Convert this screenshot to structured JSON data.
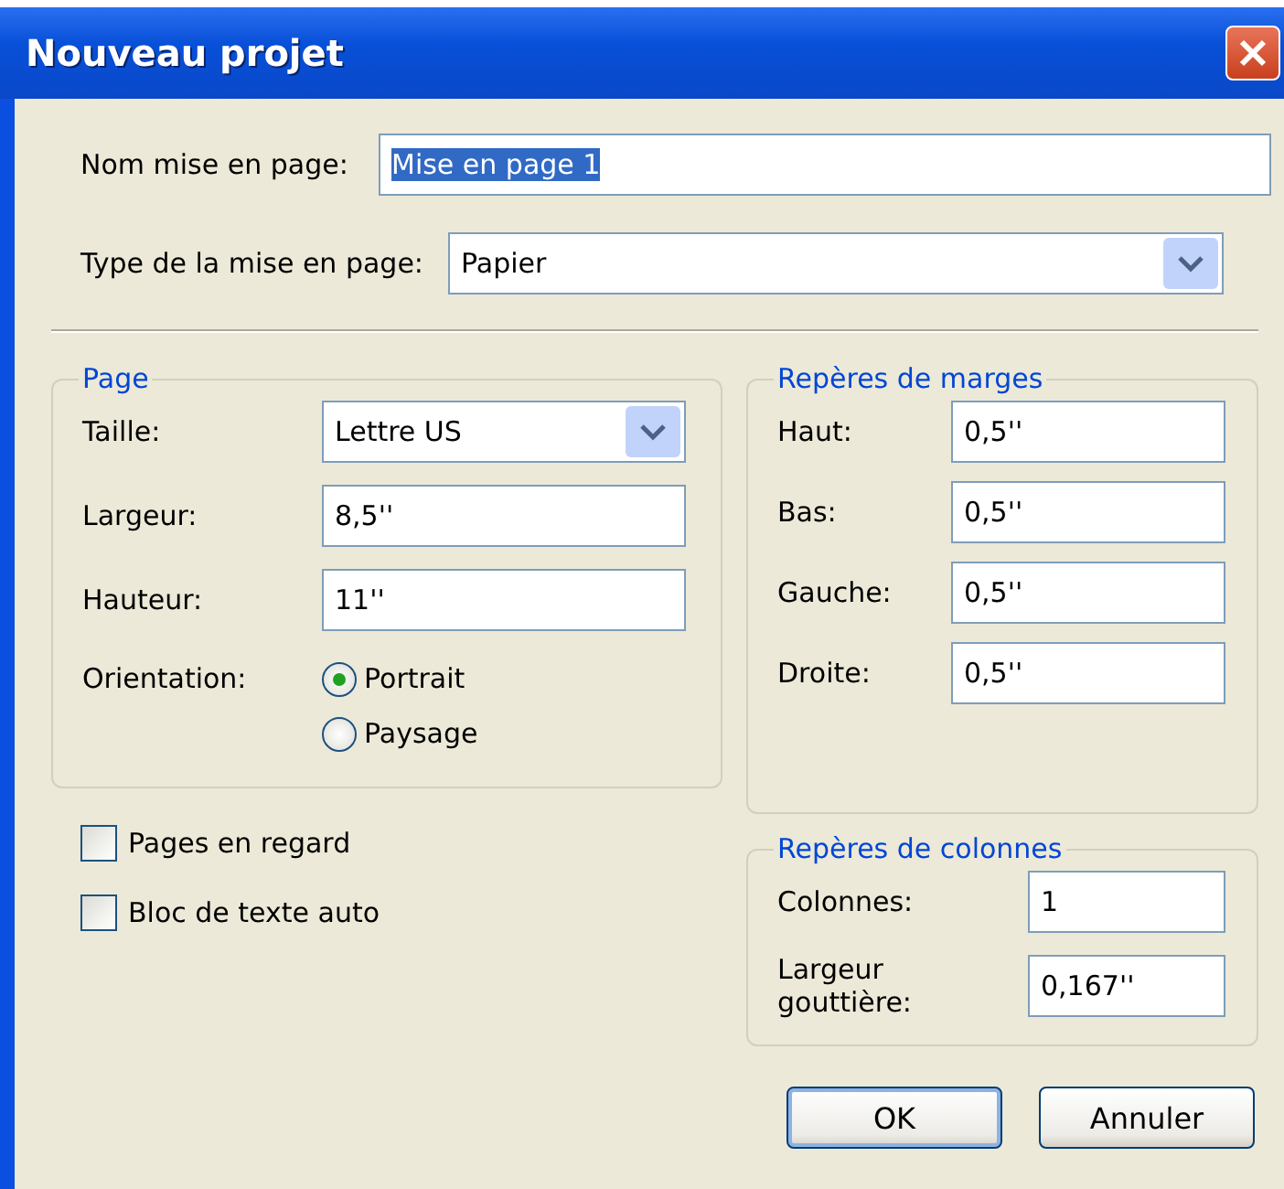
{
  "window": {
    "title": "Nouveau projet"
  },
  "name_field": {
    "label": "Nom mise en page:",
    "value": "Mise en page 1",
    "text_selected": true
  },
  "layout_type": {
    "label": "Type de la mise en page:",
    "value": "Papier"
  },
  "page_group": {
    "title": "Page",
    "size": {
      "label": "Taille:",
      "value": "Lettre US"
    },
    "fields": [
      {
        "label": "Largeur:",
        "value": "8,5''"
      },
      {
        "label": "Hauteur:",
        "value": "11''"
      }
    ],
    "orientation": {
      "label": "Orientation:",
      "options": [
        {
          "label": "Portrait",
          "selected": true
        },
        {
          "label": "Paysage",
          "selected": false
        }
      ]
    }
  },
  "options": [
    {
      "label": "Pages en regard",
      "checked": false
    },
    {
      "label": "Bloc de texte auto",
      "checked": false
    }
  ],
  "margins": {
    "title": "Repères de marges",
    "fields": [
      {
        "label": "Haut:",
        "value": "0,5''"
      },
      {
        "label": "Bas:",
        "value": "0,5''"
      },
      {
        "label": "Gauche:",
        "value": "0,5''"
      },
      {
        "label": "Droite:",
        "value": "0,5''"
      }
    ]
  },
  "columns": {
    "title": "Repères de colonnes",
    "fields": [
      {
        "label": "Colonnes:",
        "value": "1"
      },
      {
        "label": "Largeur gouttière:",
        "value": "0,167''"
      }
    ]
  },
  "buttons": [
    {
      "label": "OK",
      "default": true
    },
    {
      "label": "Annuler",
      "default": false
    }
  ]
}
